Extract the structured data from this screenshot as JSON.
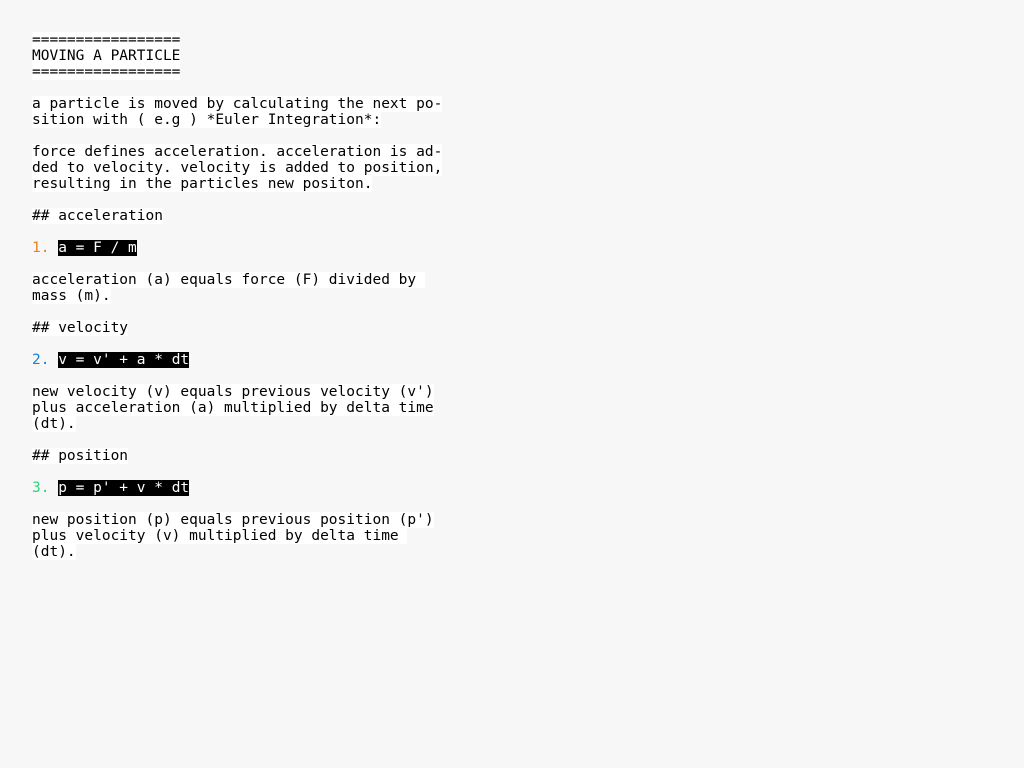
{
  "title": {
    "rule_top": "=================",
    "text": "MOVING A PARTICLE",
    "rule_bottom": "================="
  },
  "intro": {
    "line1": "a particle is moved by calculating the next po-",
    "line2": "sition with ( e.g ) *Euler Integration*:"
  },
  "summary": {
    "line1": "force defines acceleration. acceleration is ad-",
    "line2": "ded to velocity. velocity is added to position,",
    "line3": "resulting in the particles new positon."
  },
  "acceleration": {
    "heading": "## acceleration",
    "number": "1.",
    "number_color": "#e8821e",
    "formula": "a = F / m",
    "desc1": "acceleration (a) equals force (F) divided by ",
    "desc2": "mass (m)."
  },
  "velocity": {
    "heading": "## velocity",
    "number": "2.",
    "number_color": "#1e7fd6",
    "formula": "v = v' + a * dt",
    "desc1": "new velocity (v) equals previous velocity (v')",
    "desc2": "plus acceleration (a) multiplied by delta time",
    "desc3": "(dt)."
  },
  "position": {
    "heading": "## position",
    "number": "3.",
    "number_color": "#2ad67a",
    "formula": "p = p' + v * dt",
    "desc1": "new position (p) equals previous position (p')",
    "desc2": "plus velocity (v) multiplied by delta time ",
    "desc3": "(dt)."
  }
}
